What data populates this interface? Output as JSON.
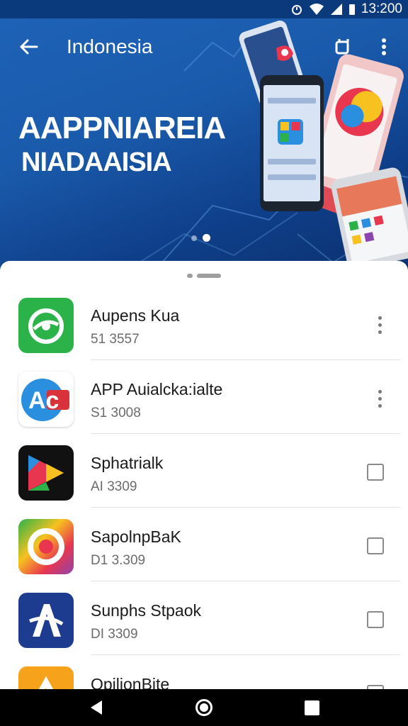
{
  "status_bar": {
    "time": "13:200"
  },
  "toolbar": {
    "title": "Indonesia"
  },
  "hero": {
    "title": "AAPPNIAREIA",
    "subtitle": "NIADAAISIA",
    "page_indicator": {
      "count": 2,
      "active": 2
    }
  },
  "apps": [
    {
      "name": "Aupens Kua",
      "size": "51 3557",
      "action": "overflow-menu",
      "icon": "chat-bubbles-icon",
      "color": "#2bb34a"
    },
    {
      "name": "APP Auialcka:ialte",
      "size": "S1 3008",
      "action": "overflow-menu",
      "icon": "ac-logo-icon",
      "color": "#2b8fe0"
    },
    {
      "name": "Sphatrialk",
      "size": "AI 3309",
      "action": "checkbox",
      "icon": "color-play-icon",
      "color": "#111111"
    },
    {
      "name": "SapolnpBaK",
      "size": "D1 3.309",
      "action": "checkbox",
      "icon": "color-ring-icon",
      "color": "#e63b6a"
    },
    {
      "name": "Sunphs Stpaok",
      "size": "DI 3309",
      "action": "checkbox",
      "icon": "a-star-icon",
      "color": "#1d3c8f"
    },
    {
      "name": "OpilionBite",
      "size": "",
      "action": "checkbox",
      "icon": "orange-arch-icon",
      "color": "#f7a21b"
    }
  ],
  "colors": {
    "header": "#1a5aab",
    "status_bar": "#0b3a7c",
    "accent_green": "#2bb34a"
  }
}
